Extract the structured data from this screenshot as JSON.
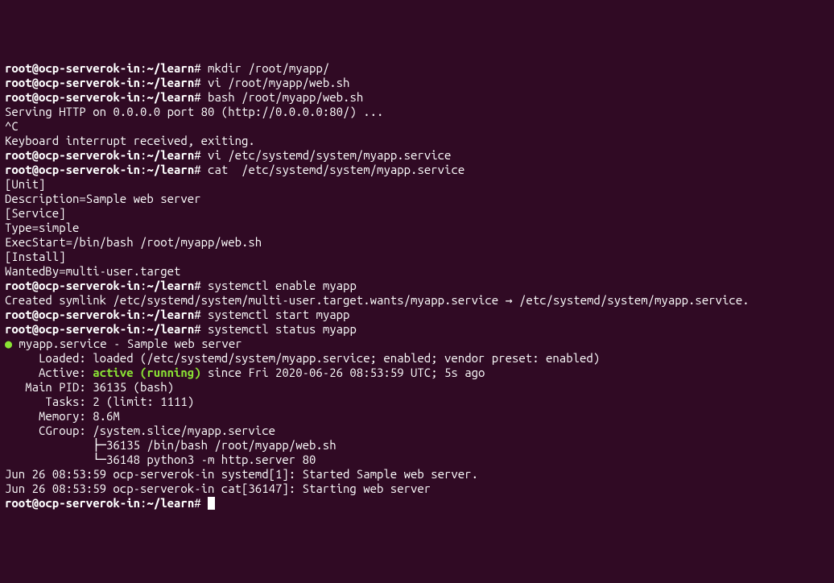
{
  "prompt": {
    "userHost": "root@ocp-serverok-in",
    "sep1": ":",
    "path": "~/learn",
    "sep2": "# "
  },
  "lines": {
    "cmd1": "mkdir /root/myapp/",
    "cmd2": "vi /root/myapp/web.sh",
    "cmd3": "bash /root/myapp/web.sh",
    "out1": "Serving HTTP on 0.0.0.0 port 80 (http://0.0.0.0:80/) ...",
    "out2": "^C",
    "out3": "Keyboard interrupt received, exiting.",
    "cmd4": "vi /etc/systemd/system/myapp.service",
    "cmd5": "cat  /etc/systemd/system/myapp.service",
    "svc1": "[Unit]",
    "svc2": "Description=Sample web server",
    "svc3": "",
    "svc4": "[Service]",
    "svc5": "Type=simple",
    "svc6": "ExecStart=/bin/bash /root/myapp/web.sh",
    "svc7": "",
    "svc8": "[Install]",
    "svc9": "WantedBy=multi-user.target",
    "cmd6": "systemctl enable myapp",
    "out4": "Created symlink /etc/systemd/system/multi-user.target.wants/myapp.service → /etc/systemd/system/myapp.service.",
    "cmd7": "systemctl start myapp",
    "cmd8": "systemctl status myapp",
    "status1a": " myapp.service - Sample web server",
    "status2": "     Loaded: loaded (/etc/systemd/system/myapp.service; enabled; vendor preset: enabled)",
    "status3a": "     Active: ",
    "status3b": "active (running)",
    "status3c": " since Fri 2020-06-26 08:53:59 UTC; 5s ago",
    "status4": "   Main PID: 36135 (bash)",
    "status5": "      Tasks: 2 (limit: 1111)",
    "status6": "     Memory: 8.6M",
    "status7": "     CGroup: /system.slice/myapp.service",
    "status8": "             ├─36135 /bin/bash /root/myapp/web.sh",
    "status9": "             └─36148 python3 -m http.server 80",
    "blank": "",
    "log1": "Jun 26 08:53:59 ocp-serverok-in systemd[1]: Started Sample web server.",
    "log2": "Jun 26 08:53:59 ocp-serverok-in cat[36147]: Starting web server",
    "dot": "●"
  }
}
